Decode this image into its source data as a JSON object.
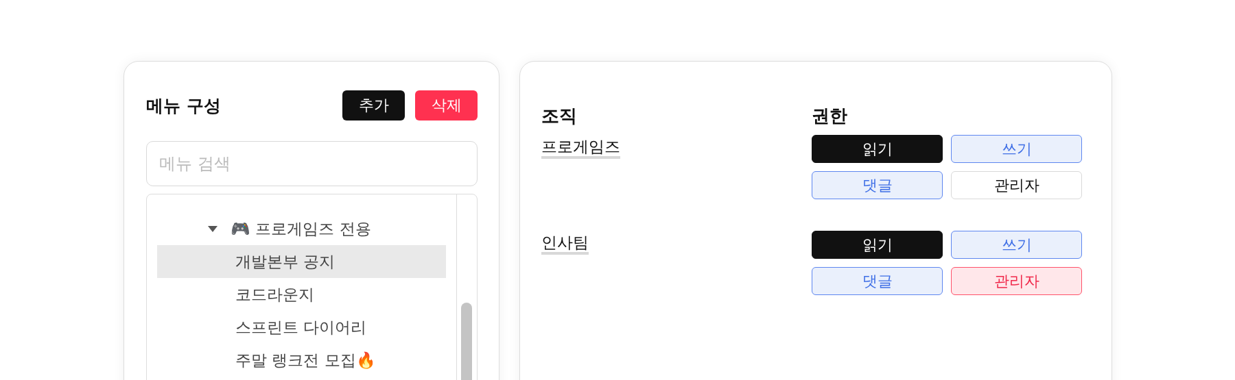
{
  "menu_panel": {
    "title": "메뉴 구성",
    "buttons": [
      {
        "label": "추가",
        "kind": "primary"
      },
      {
        "label": "삭제",
        "kind": "danger"
      }
    ],
    "search": {
      "placeholder": "메뉴 검색"
    },
    "tree": [
      {
        "label": "🎮 프로게임즈 전용",
        "expanded": true,
        "selected": false,
        "children": [
          {
            "label": "개발본부 공지",
            "selected": true
          },
          {
            "label": "코드라운지",
            "selected": false
          },
          {
            "label": "스프린트 다이어리",
            "selected": false
          },
          {
            "label": "주말 랭크전 모집🔥",
            "selected": false
          }
        ]
      }
    ]
  },
  "permission_panel": {
    "columns": [
      "조직",
      "권한"
    ],
    "rows": [
      {
        "organization": "프로게임즈",
        "permissions": [
          {
            "label": "읽기",
            "kind": "dark",
            "selected": true
          },
          {
            "label": "쓰기",
            "kind": "blue",
            "selected": true
          },
          {
            "label": "댓글",
            "kind": "blue",
            "selected": true
          },
          {
            "label": "관리자",
            "kind": "red",
            "selected": false
          }
        ]
      },
      {
        "organization": "인사팀",
        "permissions": [
          {
            "label": "읽기",
            "kind": "dark",
            "selected": true
          },
          {
            "label": "쓰기",
            "kind": "blue",
            "selected": true
          },
          {
            "label": "댓글",
            "kind": "blue",
            "selected": true
          },
          {
            "label": "관리자",
            "kind": "red",
            "selected": true
          }
        ]
      }
    ]
  }
}
